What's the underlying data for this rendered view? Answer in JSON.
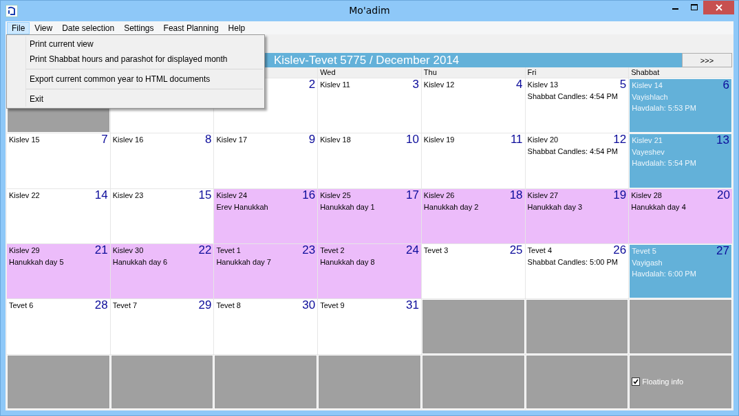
{
  "window": {
    "title": "Mo'adim"
  },
  "menu": [
    {
      "label": "File",
      "selected": true
    },
    {
      "label": "View",
      "selected": false
    },
    {
      "label": "Date selection",
      "selected": false
    },
    {
      "label": "Settings",
      "selected": false
    },
    {
      "label": "Feast Planning",
      "selected": false
    },
    {
      "label": "Help",
      "selected": false
    }
  ],
  "file_menu": [
    {
      "label": "Print current view",
      "separator_before": false
    },
    {
      "label": "Print Shabbat hours and parashot for displayed month",
      "separator_before": false
    },
    {
      "label": "Export current common year to HTML documents",
      "separator_before": true
    },
    {
      "label": "Exit",
      "separator_before": true
    }
  ],
  "header": {
    "title": "Kislev-Tevet 5775 / December 2014",
    "next_button": ">>>"
  },
  "columns": [
    "",
    "",
    "",
    "Wed",
    "Thu",
    "Fri",
    "Shabbat"
  ],
  "weeks": [
    [
      {
        "kind": "empty"
      },
      {
        "kind": "normal"
      },
      {
        "kind": "normal",
        "number": "2"
      },
      {
        "kind": "normal",
        "hebrew": "Kislev 11",
        "number": "3"
      },
      {
        "kind": "normal",
        "hebrew": "Kislev 12",
        "number": "4"
      },
      {
        "kind": "normal",
        "hebrew": "Kislev 13",
        "number": "5",
        "lines": [
          "Shabbat Candles: 4:54 PM"
        ]
      },
      {
        "kind": "shabbat",
        "hebrew": "Kislev 14",
        "number": "6",
        "lines": [
          "Vayishlach",
          "Havdalah: 5:53 PM"
        ]
      }
    ],
    [
      {
        "kind": "normal",
        "hebrew": "Kislev 15",
        "number": "7"
      },
      {
        "kind": "normal",
        "hebrew": "Kislev 16",
        "number": "8"
      },
      {
        "kind": "normal",
        "hebrew": "Kislev 17",
        "number": "9"
      },
      {
        "kind": "normal",
        "hebrew": "Kislev 18",
        "number": "10"
      },
      {
        "kind": "normal",
        "hebrew": "Kislev 19",
        "number": "11"
      },
      {
        "kind": "normal",
        "hebrew": "Kislev 20",
        "number": "12",
        "lines": [
          "Shabbat Candles: 4:54 PM"
        ]
      },
      {
        "kind": "shabbat",
        "hebrew": "Kislev 21",
        "number": "13",
        "lines": [
          "Vayeshev",
          "Havdalah: 5:54 PM"
        ]
      }
    ],
    [
      {
        "kind": "normal",
        "hebrew": "Kislev 22",
        "number": "14"
      },
      {
        "kind": "normal",
        "hebrew": "Kislev 23",
        "number": "15"
      },
      {
        "kind": "feast",
        "hebrew": "Kislev 24",
        "number": "16",
        "lines": [
          "Erev Hanukkah"
        ]
      },
      {
        "kind": "feast",
        "hebrew": "Kislev 25",
        "number": "17",
        "lines": [
          "Hanukkah day 1"
        ]
      },
      {
        "kind": "feast",
        "hebrew": "Kislev 26",
        "number": "18",
        "lines": [
          "Hanukkah day 2"
        ]
      },
      {
        "kind": "feast",
        "hebrew": "Kislev 27",
        "number": "19",
        "lines": [
          "Hanukkah day 3"
        ]
      },
      {
        "kind": "feast",
        "hebrew": "Kislev 28",
        "number": "20",
        "lines": [
          "Hanukkah day 4"
        ]
      }
    ],
    [
      {
        "kind": "feast",
        "hebrew": "Kislev 29",
        "number": "21",
        "lines": [
          "Hanukkah day 5"
        ]
      },
      {
        "kind": "feast",
        "hebrew": "Kislev 30",
        "number": "22",
        "lines": [
          "Hanukkah day 6"
        ]
      },
      {
        "kind": "feast",
        "hebrew": "Tevet 1",
        "number": "23",
        "lines": [
          "Hanukkah day 7"
        ]
      },
      {
        "kind": "feast",
        "hebrew": "Tevet 2",
        "number": "24",
        "lines": [
          "Hanukkah day 8"
        ]
      },
      {
        "kind": "normal",
        "hebrew": "Tevet 3",
        "number": "25"
      },
      {
        "kind": "normal",
        "hebrew": "Tevet 4",
        "number": "26",
        "lines": [
          "Shabbat Candles: 5:00 PM"
        ]
      },
      {
        "kind": "shabbat",
        "hebrew": "Tevet 5",
        "number": "27",
        "lines": [
          "Vayigash",
          "Havdalah: 6:00 PM"
        ]
      }
    ],
    [
      {
        "kind": "normal",
        "hebrew": "Tevet 6",
        "number": "28"
      },
      {
        "kind": "normal",
        "hebrew": "Tevet 7",
        "number": "29"
      },
      {
        "kind": "normal",
        "hebrew": "Tevet 8",
        "number": "30"
      },
      {
        "kind": "normal",
        "hebrew": "Tevet 9",
        "number": "31"
      },
      {
        "kind": "empty"
      },
      {
        "kind": "empty"
      },
      {
        "kind": "empty"
      }
    ],
    [
      {
        "kind": "empty"
      },
      {
        "kind": "empty"
      },
      {
        "kind": "empty"
      },
      {
        "kind": "empty"
      },
      {
        "kind": "empty"
      },
      {
        "kind": "empty"
      },
      {
        "kind": "empty"
      }
    ]
  ],
  "floating_info": {
    "label": "Floating info",
    "checked": true
  }
}
